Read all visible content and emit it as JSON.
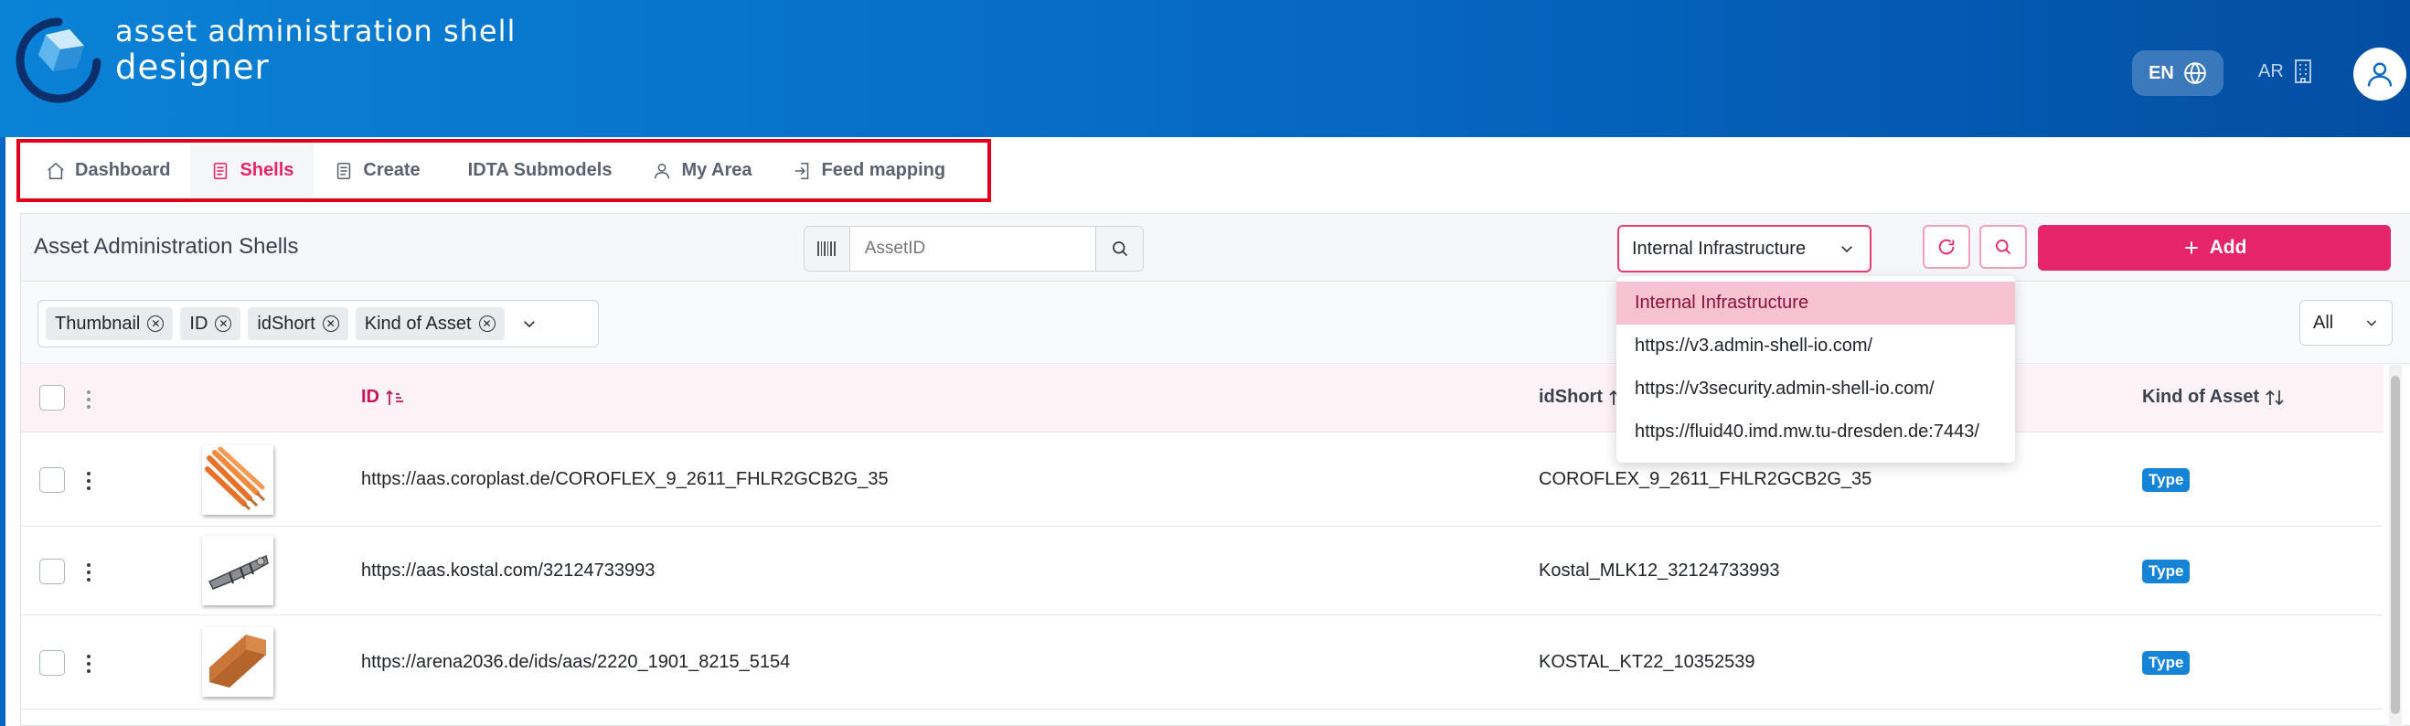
{
  "app": {
    "title_line1": "asset administration shell",
    "title_line2": "designer"
  },
  "header": {
    "language": "EN",
    "org": "AR"
  },
  "nav": {
    "items": [
      {
        "label": "Dashboard",
        "icon": "home-icon"
      },
      {
        "label": "Shells",
        "icon": "document-icon",
        "active": true
      },
      {
        "label": "Create",
        "icon": "document-icon"
      },
      {
        "label": "IDTA Submodels",
        "icon": ""
      },
      {
        "label": "My Area",
        "icon": "user-icon"
      },
      {
        "label": "Feed mapping",
        "icon": "login-icon"
      }
    ]
  },
  "toolbar": {
    "title": "Asset Administration Shells",
    "search_placeholder": "AssetID",
    "repository_selected": "Internal Infrastructure",
    "add_label": "Add"
  },
  "repository_options": [
    "Internal Infrastructure",
    "https://v3.admin-shell-io.com/",
    "https://v3security.admin-shell-io.com/",
    "https://fluid40.imd.mw.tu-dresden.de:7443/"
  ],
  "filters": {
    "columns": [
      "Thumbnail",
      "ID",
      "idShort",
      "Kind of Asset"
    ],
    "kind_filter": "All"
  },
  "table": {
    "headers": {
      "id": "ID",
      "idshort": "idShort",
      "kind": "Kind of Asset"
    },
    "rows": [
      {
        "id": "https://aas.coroplast.de/COROFLEX_9_2611_FHLR2GCB2G_35",
        "idshort": "COROFLEX_9_2611_FHLR2GCB2G_35",
        "kind": "Type"
      },
      {
        "id": "https://aas.kostal.com/32124733993",
        "idshort": "Kostal_MLK12_32124733993",
        "kind": "Type"
      },
      {
        "id": "https://arena2036.de/ids/aas/2220_1901_8215_5154",
        "idshort": "KOSTAL_KT22_10352539",
        "kind": "Type"
      }
    ]
  },
  "colors": {
    "accent": "#e6246a",
    "header_blue": "#0668c2",
    "badge_blue": "#1583d6",
    "highlight_border": "#e3001b"
  }
}
